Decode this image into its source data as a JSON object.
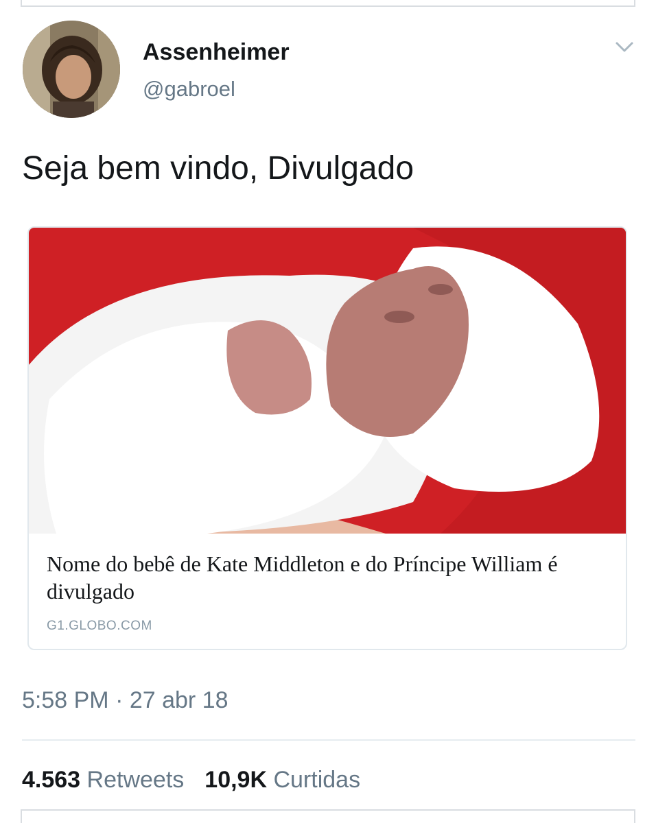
{
  "tweet": {
    "author": {
      "display_name": "Assenheimer",
      "handle": "@gabroel"
    },
    "text": "Seja bem vindo, Divulgado",
    "link_card": {
      "title": "Nome do bebê de Kate Middleton e do Príncipe William é divulgado",
      "domain": "G1.GLOBO.COM"
    },
    "timestamp": "5:58 PM · 27 abr 18",
    "stats": {
      "retweets_count": "4.563",
      "retweets_label": "Retweets",
      "likes_count": "10,9K",
      "likes_label": "Curtidas"
    }
  },
  "icons": {
    "caret": "chevron-down-icon"
  },
  "colors": {
    "text_primary": "#14171a",
    "text_secondary": "#657786",
    "border": "#e1e8ed",
    "photo_red": "#d3252a"
  }
}
